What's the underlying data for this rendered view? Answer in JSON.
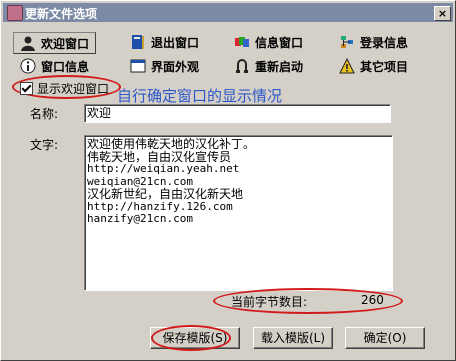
{
  "window": {
    "title": "更新文件选项",
    "close_glyph": "×"
  },
  "tabs": [
    {
      "label": "欢迎窗口",
      "icon": "user-silhouette-icon"
    },
    {
      "label": "退出窗口",
      "icon": "book-icon"
    },
    {
      "label": "信息窗口",
      "icon": "colorful-cards-icon"
    },
    {
      "label": "登录信息",
      "icon": "tree-icon"
    },
    {
      "label": "窗口信息",
      "icon": "info-icon"
    },
    {
      "label": "界面外观",
      "icon": "window-icon"
    },
    {
      "label": "重新启动",
      "icon": "restart-icon"
    },
    {
      "label": "其它项目",
      "icon": "warning-icon"
    }
  ],
  "form": {
    "show_welcome_label": "显示欢迎窗口",
    "show_welcome_checked": true,
    "annotation": "自行确定窗口的显示情况",
    "name_label": "名称:",
    "name_value": "欢迎",
    "text_label": "文字:",
    "text_lines": [
      "欢迎使用伟乾天地的汉化补丁。",
      "伟乾天地，自由汉化宣传员",
      "http://weiqian.yeah.net",
      "weiqian@21cn.com",
      "汉化新世纪，自由汉化新天地",
      "http://hanzify.126.com",
      "hanzify@21cn.com"
    ],
    "byte_count_label": "当前字节数目:",
    "byte_count_value": "260"
  },
  "buttons": {
    "save_template": "保存模版(S)",
    "load_template": "载入模版(L)",
    "ok": "确定(O)"
  },
  "colors": {
    "annotation_red": "#d11a1a",
    "annotation_blue": "#2e57c9",
    "titlebar": "#7c8aa6"
  }
}
